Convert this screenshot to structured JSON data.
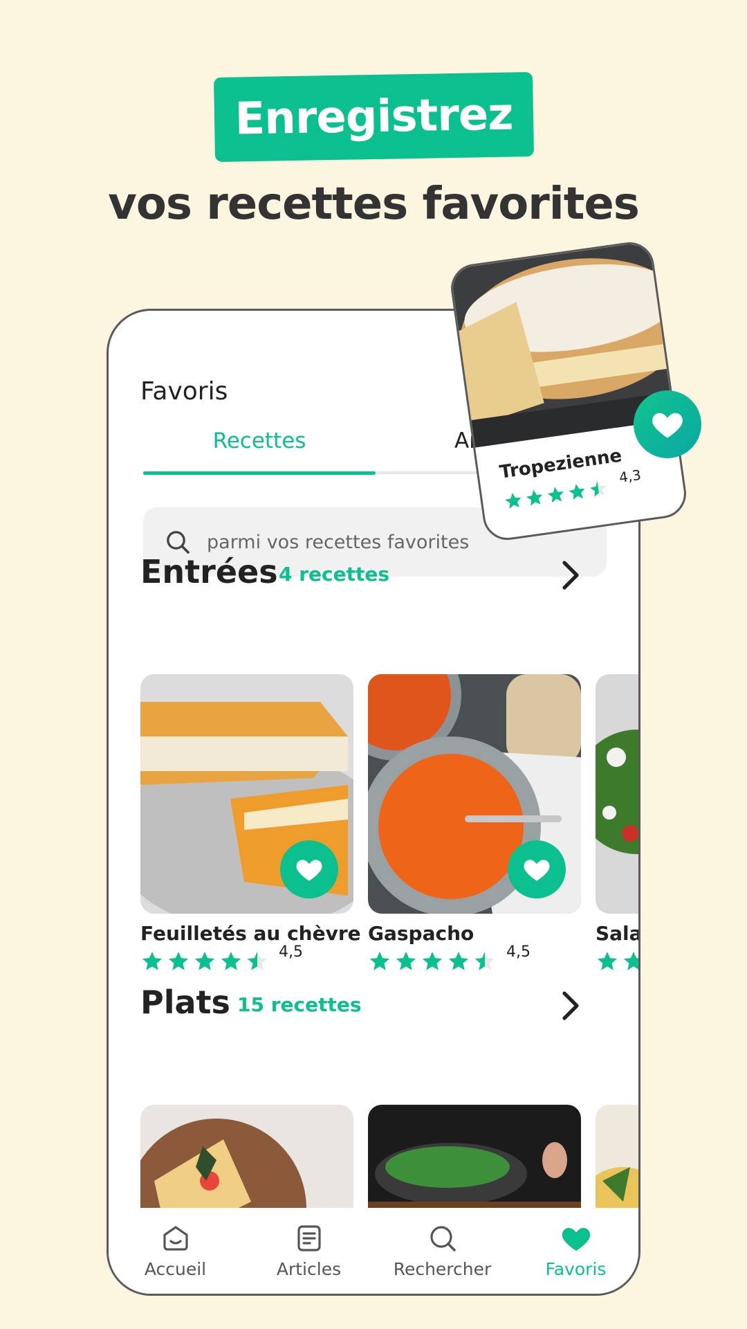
{
  "hero": {
    "badge": "Enregistrez",
    "subtitle": "vos recettes favorites"
  },
  "screen": {
    "title": "Favoris",
    "tabs": [
      {
        "label": "Recettes",
        "active": true
      },
      {
        "label": "Art",
        "active": false
      }
    ],
    "search": {
      "placeholder": "parmi vos recettes favorites"
    }
  },
  "sections": [
    {
      "name": "Entrées",
      "count": "4 recettes",
      "items": [
        {
          "title": "Feuilletés au chèvre",
          "rating": "4,5",
          "stars": 4.5
        },
        {
          "title": "Gaspacho",
          "rating": "4,5",
          "stars": 4.5
        },
        {
          "title": "Sala",
          "rating": "",
          "stars": 2
        }
      ]
    },
    {
      "name": "Plats",
      "count": "15 recettes",
      "items": [
        {
          "title": "",
          "rating": "",
          "stars": 0
        },
        {
          "title": "",
          "rating": "",
          "stars": 0
        },
        {
          "title": "",
          "rating": "",
          "stars": 0
        }
      ]
    }
  ],
  "featured": {
    "title": "Tropezienne",
    "rating": "4,3",
    "stars": 4.3
  },
  "nav": [
    {
      "label": "Accueil",
      "icon": "home-icon"
    },
    {
      "label": "Articles",
      "icon": "articles-icon"
    },
    {
      "label": "Rechercher",
      "icon": "search-icon"
    },
    {
      "label": "Favoris",
      "icon": "heart-icon",
      "active": true
    }
  ],
  "colors": {
    "accent": "#0cbf8e",
    "background": "#fcf5e0",
    "text": "#222222"
  }
}
